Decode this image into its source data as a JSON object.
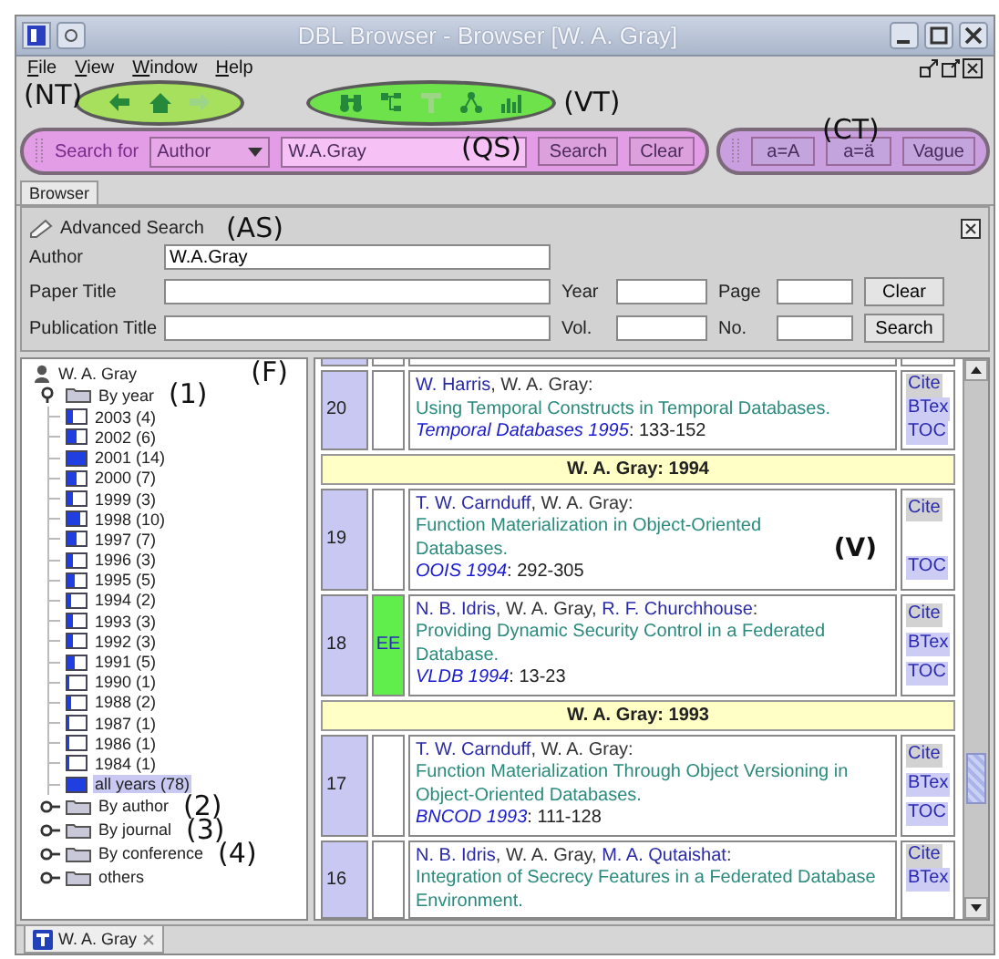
{
  "window": {
    "title": "DBL Browser - Browser [W. A. Gray]"
  },
  "menu": [
    "File",
    "View",
    "Window",
    "Help"
  ],
  "nav_toolbar": {
    "annotation": "(NT)",
    "buttons": [
      {
        "kind": "back",
        "disabled": false
      },
      {
        "kind": "home",
        "disabled": false
      },
      {
        "kind": "forward",
        "disabled": true
      }
    ]
  },
  "view_toolbar": {
    "annotation": "(VT)",
    "buttons": [
      {
        "kind": "binoculars",
        "disabled": false
      },
      {
        "kind": "tree",
        "disabled": false
      },
      {
        "kind": "text",
        "disabled": true
      },
      {
        "kind": "graph",
        "disabled": false
      },
      {
        "kind": "chart",
        "disabled": false
      }
    ]
  },
  "quick_search": {
    "annotation": "(QS)",
    "label": "Search for",
    "category": "Author",
    "value": "W.A.Gray",
    "buttons": [
      "Search",
      "Clear"
    ]
  },
  "case_toolbar": {
    "annotation": "(CT)",
    "buttons": [
      "a=A",
      "a=ä",
      "Vague"
    ]
  },
  "tabs": [
    {
      "label": "Browser",
      "selected": true
    }
  ],
  "advanced_search": {
    "title": "Advanced Search",
    "annotation": "(AS)",
    "rows": [
      {
        "fields": [
          {
            "label": "Author",
            "value": "W.A.Gray"
          }
        ]
      },
      {
        "fields": [
          {
            "label": "Paper Title"
          },
          {
            "label": "Year"
          },
          {
            "label": "Page"
          }
        ],
        "button": "Clear"
      },
      {
        "fields": [
          {
            "label": "Publication Title"
          },
          {
            "label": "Vol."
          },
          {
            "label": "No."
          }
        ],
        "button": "Search"
      }
    ]
  },
  "tree": {
    "annotation": "(F)",
    "root": {
      "label": "W. A. Gray",
      "children": [
        {
          "label": "By year",
          "expanded": true,
          "annotation": "(1)",
          "children": [
            {
              "label": "2003 (4)",
              "level": 0.3,
              "selected": false
            },
            {
              "label": "2002 (6)",
              "level": 0.45,
              "selected": false
            },
            {
              "label": "2001 (14)",
              "level": 1,
              "selected": false
            },
            {
              "label": "2000 (7)",
              "level": 0.5,
              "selected": false
            },
            {
              "label": "1999 (3)",
              "level": 0.25,
              "selected": false
            },
            {
              "label": "1998 (10)",
              "level": 0.7,
              "selected": false
            },
            {
              "label": "1997 (7)",
              "level": 0.5,
              "selected": false
            },
            {
              "label": "1996 (3)",
              "level": 0.25,
              "selected": false
            },
            {
              "label": "1995 (5)",
              "level": 0.35,
              "selected": false
            },
            {
              "label": "1994 (2)",
              "level": 0.15,
              "selected": false
            },
            {
              "label": "1993 (3)",
              "level": 0.25,
              "selected": false
            },
            {
              "label": "1992 (3)",
              "level": 0.25,
              "selected": false
            },
            {
              "label": "1991 (5)",
              "level": 0.35,
              "selected": false
            },
            {
              "label": "1990 (1)",
              "level": 0.08,
              "selected": false
            },
            {
              "label": "1988 (2)",
              "level": 0.15,
              "selected": false
            },
            {
              "label": "1987 (1)",
              "level": 0.08,
              "selected": false
            },
            {
              "label": "1986 (1)",
              "level": 0.08,
              "selected": false
            },
            {
              "label": "1984 (1)",
              "level": 0.08,
              "selected": false
            },
            {
              "label": "all years (78)",
              "level": 1,
              "selected": true
            }
          ]
        },
        {
          "label": "By author",
          "expanded": false,
          "annotation": "(2)"
        },
        {
          "label": "By journal",
          "expanded": false,
          "annotation": "(3)"
        },
        {
          "label": "By conference",
          "expanded": false,
          "annotation": "(4)"
        },
        {
          "label": "others",
          "expanded": false
        }
      ]
    }
  },
  "publications": {
    "rows": [
      {
        "kind": "entry",
        "number": "20",
        "authors": [
          {
            "text": "W. Harris",
            "link": true
          },
          {
            "text": ", W. A. Gray:",
            "link": false
          }
        ],
        "title": "Using Temporal Constructs in Temporal Databases.",
        "venue": "Temporal Databases 1995",
        "pages": ": 133-152",
        "links": [
          {
            "label": "Cite",
            "kind": "cite"
          },
          {
            "label": "BTex",
            "kind": "bibtex"
          },
          {
            "label": "TOC",
            "kind": "toc"
          }
        ]
      },
      {
        "kind": "header",
        "text": "W. A. Gray: 1994"
      },
      {
        "kind": "entry",
        "number": "19",
        "annotation": "(V)",
        "authors": [
          {
            "text": "T. W. Carnduff",
            "link": true
          },
          {
            "text": ", W. A. Gray:",
            "link": false
          }
        ],
        "title": "Function Materialization in Object-Oriented Databases.",
        "venue": "OOIS 1994",
        "pages": ": 292-305",
        "links": [
          {
            "label": "Cite",
            "kind": "cite"
          },
          {
            "label": "TOC",
            "kind": "toc"
          }
        ]
      },
      {
        "kind": "entry",
        "number": "18",
        "ee": "EE",
        "authors": [
          {
            "text": "N. B. Idris",
            "link": true
          },
          {
            "text": ", W. A. Gray, ",
            "link": false
          },
          {
            "text": "R. F. Churchhouse",
            "link": true
          },
          {
            "text": ":",
            "link": false
          }
        ],
        "title": "Providing Dynamic Security Control in a Federated Database.",
        "venue": "VLDB 1994",
        "pages": ": 13-23",
        "links": [
          {
            "label": "Cite",
            "kind": "cite"
          },
          {
            "label": "BTex",
            "kind": "bibtex"
          },
          {
            "label": "TOC",
            "kind": "toc"
          }
        ]
      },
      {
        "kind": "header",
        "text": "W. A. Gray: 1993"
      },
      {
        "kind": "entry",
        "number": "17",
        "authors": [
          {
            "text": "T. W. Carnduff",
            "link": true
          },
          {
            "text": ", W. A. Gray:",
            "link": false
          }
        ],
        "title": "Function Materialization Through Object Versioning in Object-Oriented Databases.",
        "venue": "BNCOD 1993",
        "pages": ": 111-128",
        "links": [
          {
            "label": "Cite",
            "kind": "cite"
          },
          {
            "label": "BTex",
            "kind": "bibtex"
          },
          {
            "label": "TOC",
            "kind": "toc"
          }
        ]
      },
      {
        "kind": "entry",
        "number": "16",
        "authors": [
          {
            "text": "N. B. Idris",
            "link": true
          },
          {
            "text": ", W. A. Gray, ",
            "link": false
          },
          {
            "text": "M. A. Qutaishat",
            "link": true
          },
          {
            "text": ":",
            "link": false
          }
        ],
        "title": "Integration of Secrecy Features in a Federated Database Environment.",
        "links": [
          {
            "label": "Cite",
            "kind": "cite"
          },
          {
            "label": "BTex",
            "kind": "bibtex"
          }
        ]
      }
    ]
  },
  "doc_tabs": [
    {
      "label": "W. A. Gray",
      "selected": true
    }
  ]
}
